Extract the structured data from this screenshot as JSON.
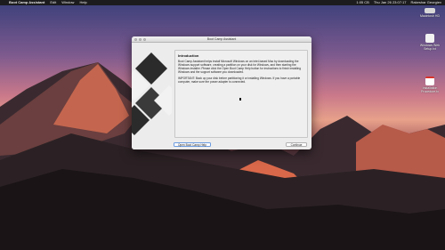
{
  "menubar": {
    "app_name": "Boot Camp Assistant",
    "items": [
      "Edit",
      "Window",
      "Help"
    ],
    "status": {
      "time": "Thu Jan 26 23:07:17",
      "zoom": "1:05 CB",
      "user": "Rakeshar Georgiev"
    }
  },
  "desktop_icons": [
    {
      "label": "Macintosh HD",
      "color": "#d8d8d8"
    },
    {
      "label": "Windows Web Setup.txt",
      "color": "#f2f2f2"
    },
    {
      "label": "Installation Procedure.tx",
      "color": "#ffffff"
    }
  ],
  "window": {
    "title": "Boot Camp Assistant",
    "heading": "Introduction",
    "paragraph1": "Boot Camp Assistant helps install Microsoft Windows on an Intel-based Mac by downloading the Windows support software, creating a partition on your disk for Windows, and then starting the Windows installer. Please click the Open Boot Camp Help button for instructions to finish installing Windows and the support software you downloaded.",
    "paragraph2": "IMPORTANT: Back up your disk before partitioning it or installing Windows. If you have a portable computer, make sure the power adapter is connected.",
    "buttons": {
      "help": "Open Boot Camp Help",
      "continue": "Continue"
    }
  },
  "colors": {
    "menubar": "#1c1c1e",
    "window_bg": "#ececec",
    "logo_dark": "#2b2b2b",
    "logo_light": "#f2f2f2"
  }
}
